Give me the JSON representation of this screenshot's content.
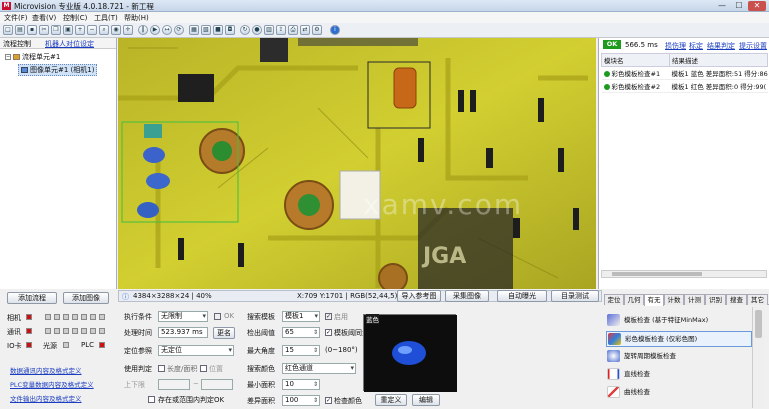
{
  "window": {
    "title": "Microvision 专业版 4.0.18.721 - 新工程",
    "app_icon": "M",
    "minimize": "—",
    "maximize": "☐",
    "close": "✕"
  },
  "menu": [
    "文件(F)",
    "查看(V)",
    "控制(C)",
    "工具(T)",
    "帮助(H)"
  ],
  "left_tabs": {
    "flow": "流程控制",
    "robot": "机器人对位设定"
  },
  "tree": {
    "root": "流程单元#1",
    "child": "图像单元#1 (相机1)"
  },
  "status": {
    "info": "4384×3288×24 | 40%",
    "coords": "X:709 Y:1701 | RGB(52,44,5)"
  },
  "image_buttons": {
    "import_ref": "导入参考图",
    "capture": "采集图像",
    "auto_expose": "自动曝光",
    "dir_test": "目录测试"
  },
  "watermark": "xamv.com",
  "result": {
    "ok": "OK",
    "time": "566.5 ms",
    "links": [
      "损伤理",
      "标定",
      "结果判定",
      "提示设置"
    ],
    "headers": [
      "模块名",
      "结果描述"
    ],
    "rows": [
      {
        "name": "彩色模板检查#1",
        "desc": "模板1 蓝色 差异面积:51 得分:86"
      },
      {
        "name": "彩色模板检查#2",
        "desc": "模板1 红色 差异面积:0 得分:99("
      }
    ]
  },
  "bottom_left": {
    "add_flow": "添加流程",
    "add_image": "添加图像",
    "camera": "相机",
    "comm": "通讯",
    "io": "IO卡",
    "light": "光源",
    "plc": "PLC",
    "links": [
      "数据通讯内容及格式定义",
      "PLC变量数据内容及格式定义",
      "文件输出内容及格式定义"
    ]
  },
  "params": {
    "exec_cond_label": "执行条件",
    "exec_cond_value": "无限制",
    "ok_label": "OK",
    "time_label": "处理时间",
    "time_value": "523.937 ms",
    "rename": "更名",
    "ref_label": "定位参照",
    "ref_value": "无定位",
    "use_judge_label": "使用判定",
    "length_area": "长度/面积",
    "position": "位置",
    "upper_lower": "上下限",
    "tilde": "~",
    "judge_in_range": "存在或范围内判定OK",
    "template_label": "搜索模板",
    "template_value": "模板1",
    "enable_label": "启用",
    "thresh_label": "检出阈值",
    "thresh_value": "65",
    "sync_label": "模板阈同步",
    "angle_label": "最大角度",
    "angle_value": "15",
    "angle_range": "(0~180°)",
    "color_label": "搜索颜色",
    "color_value": "红色通道",
    "min_area_label": "最小面积",
    "min_area_value": "10",
    "diff_area_label": "差异面积",
    "diff_area_value": "100",
    "check_color": "检查颜色",
    "redefine": "重定义",
    "edit": "编辑",
    "preview_tag": "蓝色"
  },
  "tool_tabs": [
    "定位",
    "几何",
    "有无",
    "计数",
    "计测",
    "识别",
    "搜查",
    "其它"
  ],
  "tools": [
    "模板检查 (基于特征MinMax)",
    "彩色模板检查 (仅彩色图)",
    "旋转周期模板检查",
    "直线检查",
    "曲线检查"
  ],
  "colors": {
    "ok_green": "#1e9a1e",
    "link_blue": "#1a3cc0",
    "board_yellow": "#c9c92a"
  }
}
